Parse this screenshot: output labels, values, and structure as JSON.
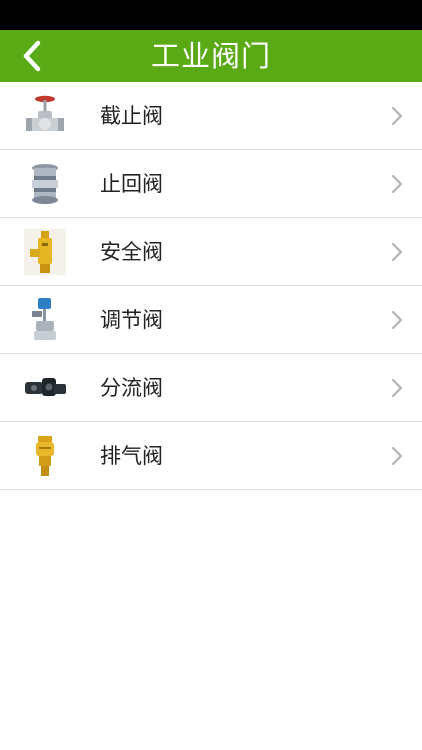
{
  "header": {
    "title": "工业阀门",
    "background_color": "#5aaa16",
    "back_icon": "chevron-left-icon"
  },
  "list": {
    "items": [
      {
        "label": "截止阀",
        "icon": "globe-valve-icon"
      },
      {
        "label": "止回阀",
        "icon": "check-valve-icon"
      },
      {
        "label": "安全阀",
        "icon": "safety-valve-icon"
      },
      {
        "label": "调节阀",
        "icon": "control-valve-icon"
      },
      {
        "label": "分流阀",
        "icon": "diverter-valve-icon"
      },
      {
        "label": "排气阀",
        "icon": "air-release-valve-icon"
      }
    ],
    "chevron_icon": "chevron-right-icon"
  }
}
